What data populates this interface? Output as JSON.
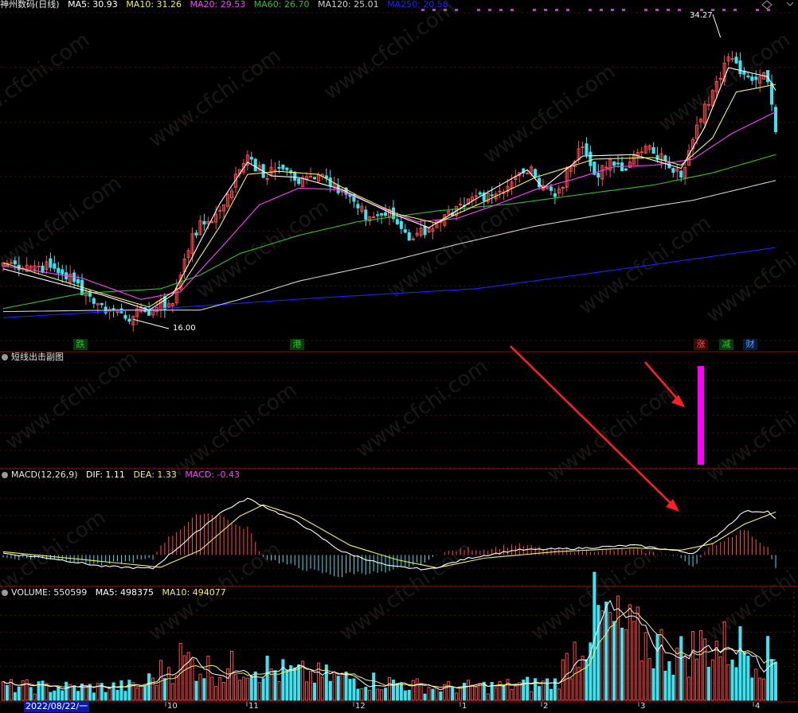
{
  "colors": {
    "background": "#000000",
    "up": "#ff4a4a",
    "down": "#3ce3f0",
    "grid": "#3a0a0a",
    "divider": "#8a1010",
    "ma5": "#ffffff",
    "ma10": "#f0f060",
    "ma20": "#ff40ff",
    "ma60": "#30c030",
    "ma120": "#cfcfcf",
    "ma250": "#2020ff",
    "subchart_bar": "#ff00ff",
    "arrow": "#ff2020",
    "watermark": "#2d2d2d"
  },
  "main_header": {
    "title": "神州数码(日线)",
    "ma5": "MA5: 30.93",
    "ma10": "MA10: 31.26",
    "ma20": "MA20: 29.53",
    "ma60": "MA60: 26.70",
    "ma120": "MA120: 25.01",
    "ma250": "MA250: 20.58"
  },
  "sub_header": {
    "title": "短线出击副图"
  },
  "macd_header": {
    "title": "MACD(12,26,9)",
    "dif": "DIF: 1.11",
    "dea": "DEA: 1.33",
    "macd": "MACD: -0.43"
  },
  "volume_header": {
    "title": "VOLUME: 550599",
    "ma5": "MA5: 498375",
    "ma10": "MA10: 494077"
  },
  "price_labels": {
    "high": "34.27",
    "low": "16.00"
  },
  "markers": [
    {
      "text": "跌",
      "color": "#30c030",
      "bg": "#0a3a0a"
    },
    {
      "text": "港",
      "color": "#30c030",
      "bg": "#0a3a0a"
    },
    {
      "text": "涨",
      "color": "#ff4a4a",
      "bg": "#3a0a0a"
    },
    {
      "text": "减",
      "color": "#30c030",
      "bg": "#0a3a0a"
    },
    {
      "text": "财",
      "color": "#4aa0ff",
      "bg": "#0a1a3a"
    }
  ],
  "axis": {
    "date_label": "2022/08/22/一",
    "month_labels": [
      "10",
      "11",
      "12",
      "1",
      "2",
      "3",
      "4"
    ]
  },
  "watermark": "www.cfchi.com",
  "chart_data": {
    "type": "candlestick",
    "title": "神州数码(日线)",
    "ylim": [
      14.5,
      36.0
    ],
    "price_high": 34.27,
    "price_low": 16.0,
    "anchors": {
      "close": [
        [
          0,
          19.6
        ],
        [
          12,
          19.3
        ],
        [
          17,
          18.6
        ],
        [
          25,
          16.7
        ],
        [
          33,
          16.1
        ],
        [
          37,
          16.5
        ],
        [
          43,
          17.0
        ],
        [
          48,
          21.5
        ],
        [
          55,
          23.0
        ],
        [
          62,
          26.8
        ],
        [
          66,
          25.2
        ],
        [
          71,
          26.0
        ],
        [
          75,
          24.8
        ],
        [
          80,
          25.6
        ],
        [
          86,
          24.4
        ],
        [
          92,
          22.6
        ],
        [
          98,
          22.8
        ],
        [
          103,
          21.3
        ],
        [
          108,
          21.9
        ],
        [
          114,
          22.7
        ],
        [
          120,
          24.0
        ],
        [
          126,
          24.3
        ],
        [
          133,
          25.7
        ],
        [
          137,
          24.8
        ],
        [
          140,
          24.0
        ],
        [
          147,
          27.2
        ],
        [
          150,
          25.4
        ],
        [
          155,
          26.2
        ],
        [
          158,
          26.0
        ],
        [
          163,
          27.1
        ],
        [
          168,
          26.3
        ],
        [
          172,
          25.6
        ],
        [
          178,
          29.7
        ],
        [
          184,
          33.3
        ],
        [
          189,
          31.8
        ],
        [
          194,
          31.8
        ],
        [
          196,
          28.2
        ]
      ],
      "ma5": [
        [
          0,
          19.2
        ],
        [
          25,
          17.5
        ],
        [
          37,
          16.5
        ],
        [
          43,
          17.5
        ],
        [
          55,
          23.5
        ],
        [
          62,
          26.2
        ],
        [
          68,
          25.3
        ],
        [
          75,
          25.2
        ],
        [
          86,
          24.4
        ],
        [
          98,
          22.9
        ],
        [
          108,
          21.9
        ],
        [
          120,
          23.8
        ],
        [
          133,
          25.7
        ],
        [
          137,
          24.5
        ],
        [
          147,
          26.6
        ],
        [
          160,
          26.7
        ],
        [
          172,
          25.8
        ],
        [
          178,
          28.5
        ],
        [
          184,
          32.4
        ],
        [
          194,
          31.8
        ],
        [
          196,
          30.9
        ]
      ],
      "ma10": [
        [
          0,
          19.6
        ],
        [
          25,
          17.6
        ],
        [
          37,
          16.7
        ],
        [
          45,
          18.0
        ],
        [
          55,
          22.0
        ],
        [
          62,
          25.4
        ],
        [
          70,
          25.6
        ],
        [
          80,
          25.4
        ],
        [
          90,
          24.0
        ],
        [
          100,
          22.8
        ],
        [
          110,
          22.2
        ],
        [
          122,
          23.6
        ],
        [
          135,
          25.2
        ],
        [
          150,
          26.4
        ],
        [
          165,
          26.5
        ],
        [
          172,
          26.0
        ],
        [
          180,
          27.8
        ],
        [
          186,
          30.8
        ],
        [
          196,
          31.3
        ]
      ],
      "ma20": [
        [
          0,
          19.4
        ],
        [
          20,
          18.6
        ],
        [
          35,
          17.2
        ],
        [
          45,
          17.7
        ],
        [
          55,
          20.5
        ],
        [
          65,
          23.4
        ],
        [
          75,
          24.5
        ],
        [
          85,
          24.4
        ],
        [
          95,
          23.3
        ],
        [
          105,
          22.3
        ],
        [
          115,
          22.5
        ],
        [
          125,
          23.4
        ],
        [
          135,
          24.4
        ],
        [
          145,
          25.1
        ],
        [
          155,
          25.9
        ],
        [
          165,
          26.0
        ],
        [
          175,
          26.4
        ],
        [
          185,
          28.1
        ],
        [
          196,
          29.5
        ]
      ],
      "ma60": [
        [
          0,
          16.6
        ],
        [
          20,
          17.6
        ],
        [
          40,
          17.9
        ],
        [
          50,
          18.8
        ],
        [
          60,
          20.2
        ],
        [
          75,
          21.4
        ],
        [
          90,
          22.3
        ],
        [
          110,
          23.0
        ],
        [
          130,
          23.5
        ],
        [
          150,
          24.2
        ],
        [
          165,
          24.7
        ],
        [
          180,
          25.5
        ],
        [
          196,
          26.7
        ]
      ],
      "ma120": [
        [
          0,
          16.4
        ],
        [
          30,
          16.5
        ],
        [
          50,
          16.5
        ],
        [
          60,
          17.2
        ],
        [
          75,
          18.4
        ],
        [
          95,
          19.5
        ],
        [
          115,
          20.8
        ],
        [
          135,
          22.0
        ],
        [
          155,
          22.9
        ],
        [
          175,
          23.7
        ],
        [
          196,
          25.0
        ]
      ],
      "ma250": [
        [
          0,
          16.0
        ],
        [
          40,
          16.6
        ],
        [
          80,
          17.3
        ],
        [
          120,
          17.9
        ],
        [
          160,
          19.3
        ],
        [
          196,
          20.6
        ]
      ]
    },
    "macd_anchors": {
      "dif": [
        [
          0,
          0.05
        ],
        [
          12,
          -0.1
        ],
        [
          25,
          -0.35
        ],
        [
          38,
          -0.42
        ],
        [
          46,
          0.4
        ],
        [
          55,
          1.3
        ],
        [
          62,
          1.75
        ],
        [
          68,
          1.4
        ],
        [
          75,
          1.0
        ],
        [
          86,
          0.1
        ],
        [
          98,
          -0.35
        ],
        [
          108,
          -0.45
        ],
        [
          118,
          -0.1
        ],
        [
          130,
          0.15
        ],
        [
          145,
          0.2
        ],
        [
          160,
          0.3
        ],
        [
          168,
          0.18
        ],
        [
          175,
          0.05
        ],
        [
          182,
          0.7
        ],
        [
          188,
          1.35
        ],
        [
          194,
          1.35
        ],
        [
          196,
          1.11
        ]
      ],
      "dea": [
        [
          0,
          0.1
        ],
        [
          25,
          -0.2
        ],
        [
          40,
          -0.38
        ],
        [
          50,
          0.15
        ],
        [
          60,
          1.2
        ],
        [
          66,
          1.55
        ],
        [
          75,
          1.2
        ],
        [
          88,
          0.3
        ],
        [
          100,
          -0.15
        ],
        [
          110,
          -0.4
        ],
        [
          122,
          -0.1
        ],
        [
          140,
          0.1
        ],
        [
          160,
          0.22
        ],
        [
          172,
          0.15
        ],
        [
          180,
          0.35
        ],
        [
          188,
          0.95
        ],
        [
          196,
          1.33
        ]
      ],
      "ylim": [
        -0.95,
        2.3
      ]
    },
    "volume_anchors": {
      "volume": [
        [
          0,
          200000
        ],
        [
          20,
          180000
        ],
        [
          35,
          200000
        ],
        [
          45,
          600000
        ],
        [
          55,
          400000
        ],
        [
          62,
          550000
        ],
        [
          70,
          400000
        ],
        [
          90,
          300000
        ],
        [
          110,
          180000
        ],
        [
          125,
          200000
        ],
        [
          140,
          250000
        ],
        [
          150,
          1200000
        ],
        [
          160,
          900000
        ],
        [
          172,
          650000
        ],
        [
          178,
          800000
        ],
        [
          188,
          750000
        ],
        [
          196,
          550599
        ]
      ],
      "ylim": [
        0,
        1350000
      ]
    },
    "sub_chart": {
      "signal_index": 176,
      "signal_value": 1.0,
      "ylim": [
        0,
        1.0
      ]
    },
    "num_bars": 197
  }
}
